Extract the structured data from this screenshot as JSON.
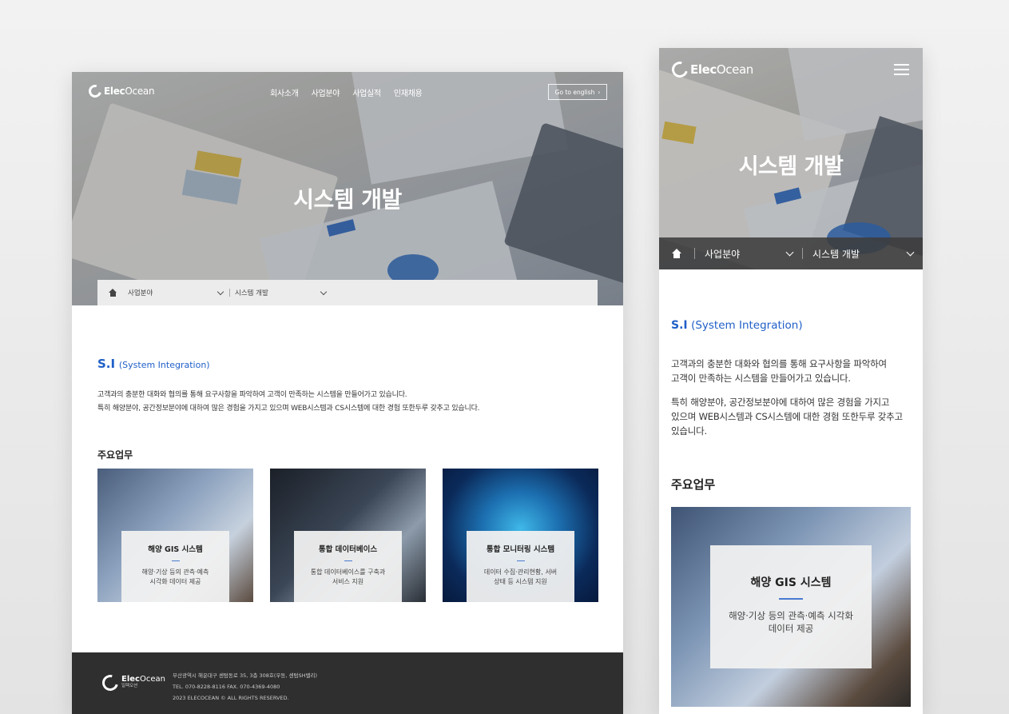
{
  "brand": {
    "logo_bold": "Elec",
    "logo_light": "Ocean",
    "logo_sub": "일렉오션"
  },
  "desktop": {
    "nav": [
      "회사소개",
      "사업분야",
      "사업실적",
      "인재채용"
    ],
    "go_english": "Go to english",
    "hero_title": "시스템 개발",
    "breadcrumb": {
      "level1": "사업분야",
      "level2": "시스템 개발"
    },
    "si_abbr": "S.I",
    "si_full": "(System Integration)",
    "description": [
      "고객과의 충분한 대화와 협의를 통해 요구사항을 파악하여 고객이 만족하는 시스템을 만들어가고 있습니다.",
      "특히 해양분야, 공간정보분야에 대하여 많은 경험을 가지고 있으며 WEB시스템과 CS시스템에 대한 경험 또한두루 갖추고 있습니다."
    ],
    "main_tasks_title": "주요업무",
    "cards": [
      {
        "title": "해양 GIS 시스템",
        "desc1": "해양·기상 등의 관측·예측",
        "desc2": "시각화 데이터 제공"
      },
      {
        "title": "통합 데이터베이스",
        "desc1": "통합 데이터베이스를 구축과",
        "desc2": "서비스 지원"
      },
      {
        "title": "통합 모니터링 시스템",
        "desc1": "데이터 수집·관리현황, 서버",
        "desc2": "상태 등 시스템 지원"
      }
    ],
    "footer": {
      "address": "부산광역시 해운대구 센텀동로 35, 3층 308호(우동, 센텀SH밸리)",
      "contact": "TEL. 070-8228-8116    FAX. 070-4369-4080",
      "copyright": "2023 ELECOCEAN © ALL RIGHTS RESERVED."
    }
  },
  "mobile": {
    "hero_title": "시스템 개발",
    "breadcrumb": {
      "level1": "사업분야",
      "level2": "시스템 개발"
    },
    "si_abbr": "S.I",
    "si_full": "(System Integration)",
    "desc_p1": [
      "고객과의 충분한 대화와 협의를 통해 요구사항을 파악하여",
      "고객이 만족하는 시스템을 만들어가고 있습니다."
    ],
    "desc_p2": [
      "특히 해양분야, 공간정보분야에 대하여 많은 경험을 가지고",
      "있으며 WEB시스템과 CS시스템에 대한 경험 또한두루 갖추고",
      "있습니다."
    ],
    "main_tasks_title": "주요업무",
    "card": {
      "title": "해양 GIS 시스템",
      "desc1": "해양·기상 등의 관측·예측 시각화",
      "desc2": "데이터 제공"
    }
  },
  "icons": [
    "home-icon",
    "chevron-down-icon",
    "chevron-right-icon",
    "hamburger-menu-icon",
    "logo-ring-icon"
  ],
  "colors": {
    "accent_blue": "#1f5fc7",
    "footer_bg": "#2f2f2f",
    "crumb_bg_desktop": "#ececec"
  }
}
